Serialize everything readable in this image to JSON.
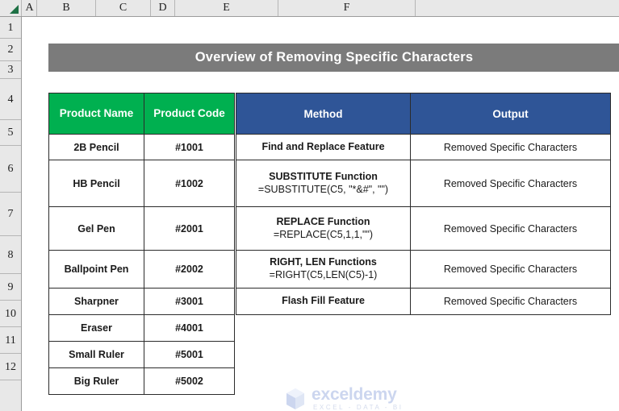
{
  "spreadsheet": {
    "column_headers": [
      "A",
      "B",
      "C",
      "D",
      "E",
      "F"
    ],
    "row_headers": [
      "1",
      "2",
      "3",
      "4",
      "5",
      "6",
      "7",
      "8",
      "9",
      "10",
      "11",
      "12"
    ],
    "select_all_icon": "select-all-triangle"
  },
  "title_banner": {
    "text": "Overview of Removing Specific Characters",
    "background": "#7B7B7B",
    "text_color": "#FFFFFF"
  },
  "product_table": {
    "header_color": "#00B050",
    "headers": [
      "Product Name",
      "Product Code"
    ],
    "rows": [
      {
        "name": "2B Pencil",
        "code": "#1001"
      },
      {
        "name": "HB Pencil",
        "code": "#1002"
      },
      {
        "name": "Gel Pen",
        "code": "#2001"
      },
      {
        "name": "Ballpoint Pen",
        "code": "#2002"
      },
      {
        "name": "Sharpner",
        "code": "#3001"
      },
      {
        "name": "Eraser",
        "code": "#4001"
      },
      {
        "name": "Small Ruler",
        "code": "#5001"
      },
      {
        "name": "Big Ruler",
        "code": "#5002"
      }
    ]
  },
  "method_table": {
    "header_color": "#2F5597",
    "headers": [
      "Method",
      "Output"
    ],
    "rows": [
      {
        "method": "Find and Replace Feature",
        "formula": "",
        "output": "Removed Specific Characters"
      },
      {
        "method": "SUBSTITUTE Function",
        "formula": "=SUBSTITUTE(C5, \"*&#\", \"\")",
        "output": "Removed Specific Characters"
      },
      {
        "method": "REPLACE Function",
        "formula": "=REPLACE(C5,1,1,\"\")",
        "output": "Removed Specific Characters"
      },
      {
        "method": "RIGHT, LEN Functions",
        "formula": "=RIGHT(C5,LEN(C5)-1)",
        "output": "Removed Specific Characters"
      },
      {
        "method": "Flash Fill Feature",
        "formula": "",
        "output": "Removed Specific Characters"
      }
    ]
  },
  "watermark": {
    "name": "exceldemy",
    "tagline": "EXCEL - DATA - BI",
    "logo_icon": "exceldemy-cube-logo"
  }
}
